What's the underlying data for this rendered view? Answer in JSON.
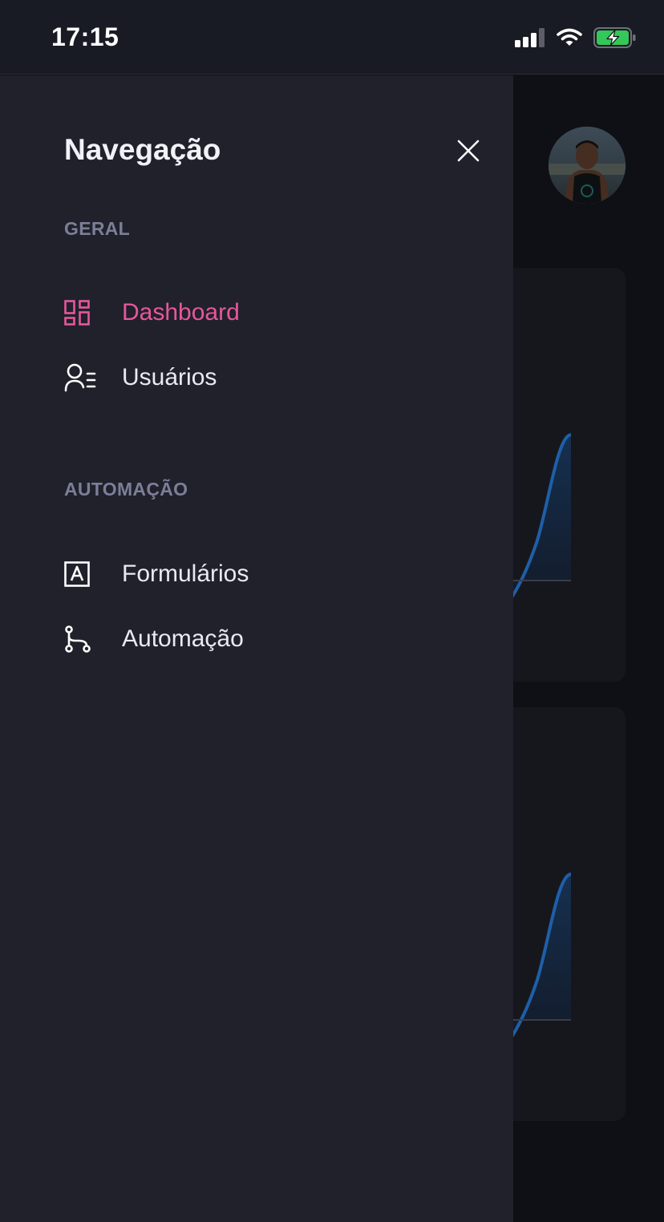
{
  "status_bar": {
    "time": "17:15",
    "icons": [
      "signal-icon",
      "wifi-icon",
      "battery-charging-icon"
    ]
  },
  "drawer": {
    "title": "Navegação",
    "sections": [
      {
        "label": "GERAL",
        "items": [
          {
            "label": "Dashboard",
            "icon": "dashboard-grid-icon",
            "active": true
          },
          {
            "label": "Usuários",
            "icon": "users-list-icon",
            "active": false
          }
        ]
      },
      {
        "label": "AUTOMAÇÃO",
        "items": [
          {
            "label": "Formulários",
            "icon": "form-letter-icon",
            "active": false
          },
          {
            "label": "Automação",
            "icon": "branch-flow-icon",
            "active": false
          }
        ]
      }
    ]
  },
  "colors": {
    "accent": "#e7579c",
    "drawer_bg": "#20212b",
    "section_label": "#7b7f98",
    "chart_line": "#1e5fa8"
  }
}
